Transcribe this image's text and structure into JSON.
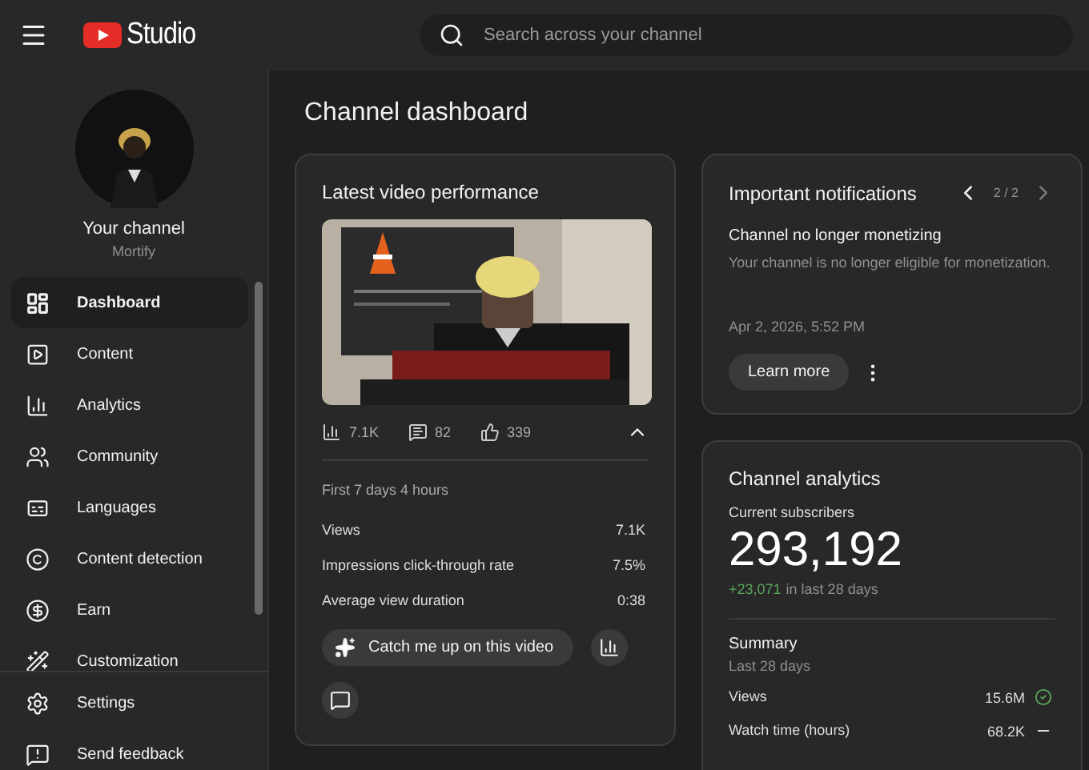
{
  "header": {
    "logo_text": "Studio",
    "search": {
      "placeholder": "Search across your channel"
    }
  },
  "sidebar": {
    "channel": {
      "title": "Your channel",
      "name": "Mortify"
    },
    "items": [
      {
        "label": "Dashboard",
        "kind": "dashboard",
        "selected": true
      },
      {
        "label": "Content",
        "kind": "content",
        "selected": false
      },
      {
        "label": "Analytics",
        "kind": "analytics",
        "selected": false
      },
      {
        "label": "Community",
        "kind": "community",
        "selected": false
      },
      {
        "label": "Languages",
        "kind": "languages",
        "selected": false
      },
      {
        "label": "Content detection",
        "kind": "copyright",
        "selected": false
      },
      {
        "label": "Earn",
        "kind": "earn",
        "selected": false
      },
      {
        "label": "Customization",
        "kind": "customization",
        "selected": false
      }
    ],
    "footer_items": [
      {
        "label": "Settings",
        "kind": "settings"
      },
      {
        "label": "Send feedback",
        "kind": "feedback"
      }
    ]
  },
  "page_title": "Channel dashboard",
  "latest_video": {
    "title": "Latest video performance",
    "stats": [
      {
        "kind": "views",
        "value": "7.1K"
      },
      {
        "kind": "comments",
        "value": "82"
      },
      {
        "kind": "likes",
        "value": "339"
      }
    ],
    "expanded": true,
    "period": "First 7 days 4 hours",
    "metrics": [
      {
        "label": "Views",
        "value": "7.1K"
      },
      {
        "label": "Impressions click-through rate",
        "value": "7.5%"
      },
      {
        "label": "Average view duration",
        "value": "0:38"
      }
    ],
    "catch_up_button": "Catch me up on this video"
  },
  "notifications": {
    "title": "Important notifications",
    "pager": "2 / 2",
    "prev_disabled": false,
    "next_disabled": true,
    "heading": "Channel no longer monetizing",
    "body": "Your channel is no longer eligible for monetization.",
    "date": "Apr 2, 2026, 5:52 PM",
    "button": "Learn more"
  },
  "channel_analytics": {
    "title": "Channel analytics",
    "subscribers_label": "Current subscribers",
    "subscribers": "293,192",
    "change": "+23,071",
    "change_period": "in last 28 days",
    "summary_title": "Summary",
    "summary_period": "Last 28 days",
    "summary": [
      {
        "label": "Views",
        "value": "15.6M",
        "kind": "up"
      },
      {
        "label": "Watch time (hours)",
        "value": "68.2K",
        "kind": "flat"
      }
    ]
  }
}
